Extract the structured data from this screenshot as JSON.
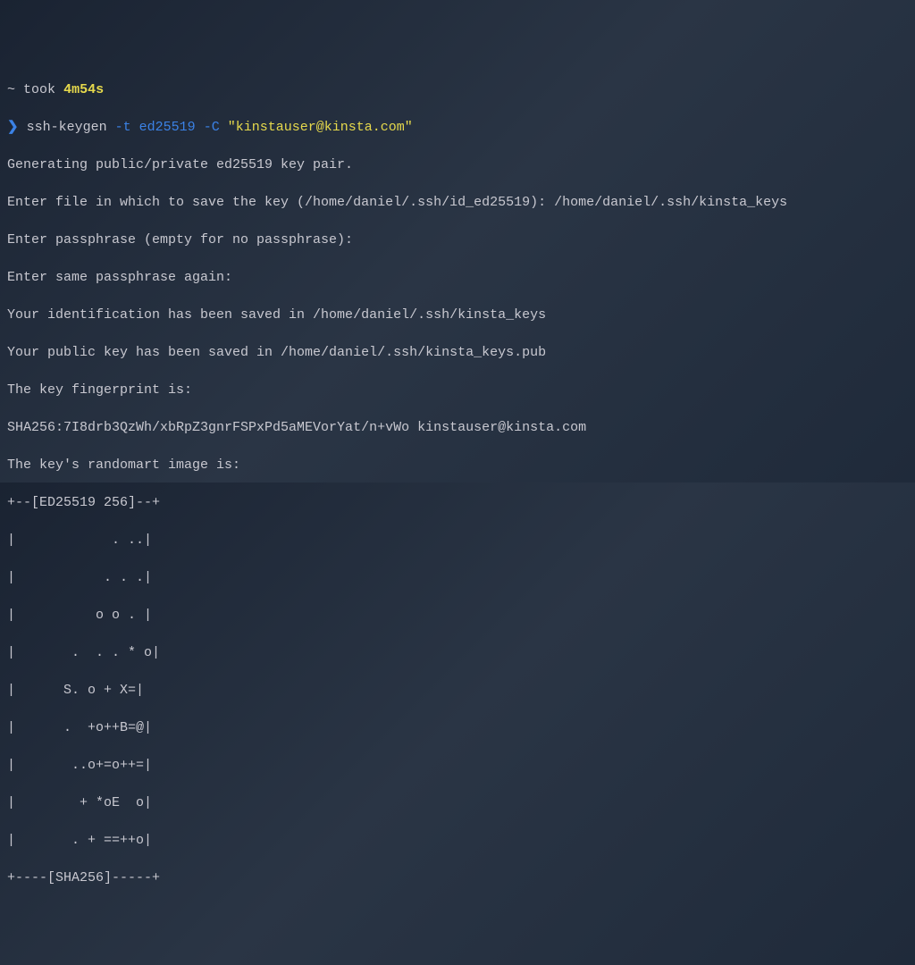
{
  "prompt_line": {
    "tilde": "~",
    "took_label": "took",
    "duration": "4m54s"
  },
  "command_line": {
    "prompt_symbol": "❯",
    "cmd": "ssh-keygen",
    "flag1": "-t",
    "arg1": "ed25519",
    "flag2": "-C",
    "string": "\"kinstauser@kinsta.com\""
  },
  "output_lines": [
    "Generating public/private ed25519 key pair.",
    "Enter file in which to save the key (/home/daniel/.ssh/id_ed25519): /home/daniel/.ssh/kinsta_keys",
    "Enter passphrase (empty for no passphrase):",
    "Enter same passphrase again:",
    "Your identification has been saved in /home/daniel/.ssh/kinsta_keys",
    "Your public key has been saved in /home/daniel/.ssh/kinsta_keys.pub",
    "The key fingerprint is:",
    "SHA256:7I8drb3QzWh/xbRpZ3gnrFSPxPd5aMEVorYat/n+vWo kinstauser@kinsta.com",
    "The key's randomart image is:",
    "+--[ED25519 256]--+",
    "|            . ..|",
    "|           . . .|",
    "|          o o . |",
    "|       .  . . * o|",
    "|      S. o + X=|",
    "|      .  +o++B=@|",
    "|       ..o+=o++=|",
    "|        + *oE  o|",
    "|       . + ==++o|",
    "+----[SHA256]-----+"
  ]
}
